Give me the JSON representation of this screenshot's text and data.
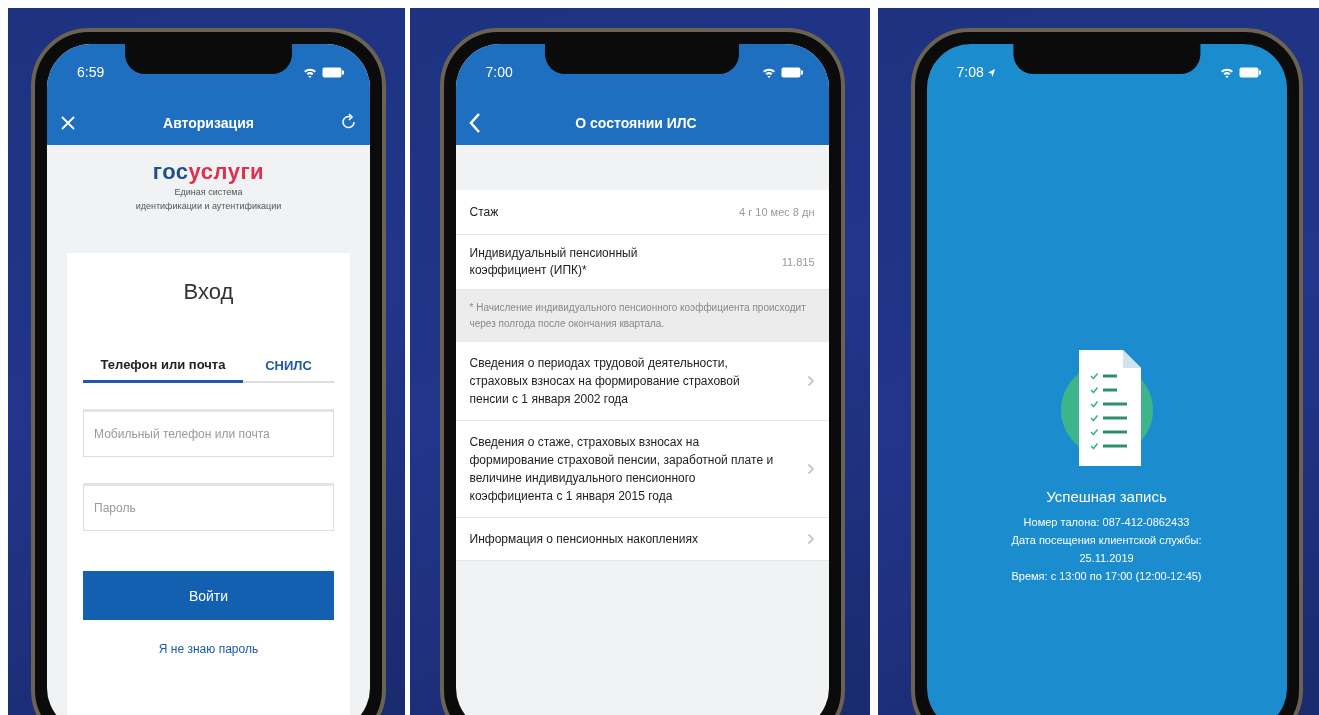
{
  "phones": [
    {
      "kind": "login",
      "status_time": "6:59",
      "nav": {
        "title": "Авторизация"
      },
      "logo": {
        "part1": "гос",
        "part2": "услуги"
      },
      "subtitle_lines": [
        "Единая система",
        "идентификации и аутентификации"
      ],
      "heading": "Вход",
      "tabs": [
        {
          "label": "Телефон или почта",
          "selected": true
        },
        {
          "label": "СНИЛС",
          "selected": false
        }
      ],
      "fields": [
        {
          "placeholder": "Мобильный телефон или почта"
        },
        {
          "placeholder": "Пароль"
        }
      ],
      "button": "Войти",
      "link": "Я не знаю пароль"
    },
    {
      "kind": "pension",
      "status_time": "7:00",
      "nav": {
        "title": "О состоянии ИЛС"
      },
      "rows": [
        {
          "label": "Стаж",
          "value": "4 г 10 мес 8 дн"
        },
        {
          "label": "Индивидуальный пенсионный коэффициент (ИПК)*",
          "value": "11.815"
        }
      ],
      "note": "* Начисление индивидуального пенсионного коэффициента происходит через полгода после окончания квартала.",
      "links": [
        "Сведения о периодах трудовой деятельности, страховых взносах на формирование страховой пенсии с 1 января 2002 года",
        "Сведения о стаже, страховых взносах на формирование страховой пенсии, заработной плате и величине индивидуального пенсионного коэффициента с 1 января 2015 года",
        "Информация о пенсионных накоплениях"
      ]
    },
    {
      "kind": "success",
      "status_time": "7:08",
      "title": "Успешная запись",
      "lines": [
        "Номер талона: 087-412-0862433",
        "Дата посещения клиентской службы:",
        "25.11.2019",
        "Время: с 13:00 по 17:00 (12:00-12:45)"
      ]
    }
  ]
}
